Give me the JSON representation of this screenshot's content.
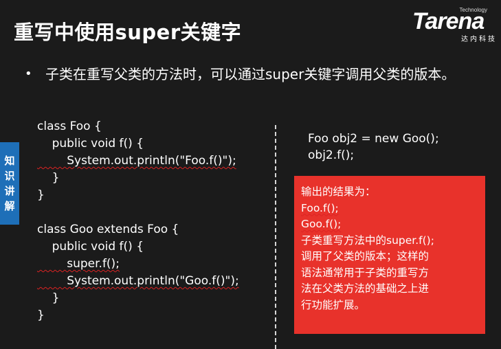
{
  "title": "重写中使用super关键字",
  "logo": {
    "technology": "Technology",
    "brand": "Tarena",
    "subtitle": "达内科技"
  },
  "bullet": {
    "symbol": "•",
    "text": "子类在重写父类的方法时，可以通过super关键字调用父类的版本。"
  },
  "side_tab": {
    "chars": [
      "知",
      "识",
      "讲",
      "解"
    ],
    "color": "#1e6fb8"
  },
  "left_code": {
    "lines": [
      "class Foo {",
      "    public void f() {",
      "        System.out.println(\"Foo.f()\");",
      "    }",
      "}",
      "",
      "class Goo extends Foo {",
      "    public void f() {",
      "        super.f();",
      "        System.out.println(\"Goo.f()\");",
      "    }",
      "}"
    ]
  },
  "right_code": {
    "lines": [
      "Foo obj2 = new Goo();",
      "obj2.f();"
    ]
  },
  "result": {
    "color": "#e8322b",
    "lines": [
      "输出的结果为：",
      "Foo.f();",
      "Goo.f();",
      "子类重写方法中的super.f();",
      "调用了父类的版本；这样的",
      "语法通常用于子类的重写方",
      "法在父类方法的基础之上进",
      "行功能扩展。"
    ]
  }
}
